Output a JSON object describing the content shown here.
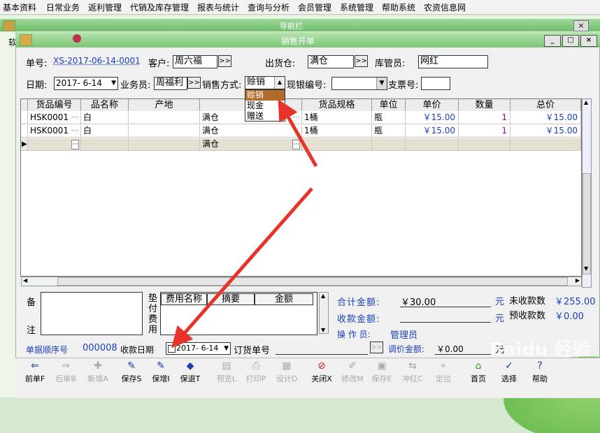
{
  "menu": [
    "基本资料",
    "日常业务",
    "返利管理",
    "代销及库存管理",
    "报表与统计",
    "查询与分析",
    "会员管理",
    "系统管理",
    "帮助系统",
    "农资信息网"
  ],
  "nav_window": {
    "title": "导航栏",
    "close": "×",
    "left_char": "软"
  },
  "sales_window": {
    "title": "销售开单",
    "btn_min": "_",
    "btn_max": "□",
    "btn_close": "×"
  },
  "header": {
    "order_no_label": "单号:",
    "order_no": "XS-2017-06-14-0001",
    "customer_label": "客户:",
    "customer": "周六福",
    "warehouse_label": "出货仓:",
    "warehouse": "满仓",
    "keeper_label": "库管员:",
    "keeper": "网红",
    "date_label": "日期:",
    "date": "2017- 6-14",
    "salesman_label": "业务员:",
    "salesman": "周福利",
    "sale_method_label": "销售方式:",
    "sale_method": "赊销",
    "cash_no_label": "现银编号:",
    "cash_no": "",
    "cheque_label": "支票号:",
    "cheque": "",
    "more_btn": ">>"
  },
  "sale_method_options": [
    "赊销",
    "现金",
    "赠送"
  ],
  "grid": {
    "columns": [
      "货品编号",
      "品名称",
      "产地",
      "出",
      "货品规格",
      "单位",
      "单价",
      "数量",
      "总价"
    ],
    "rows": [
      [
        "HSK0001",
        "白",
        "",
        "满仓",
        "1桶",
        "瓶",
        "￥15.00",
        "1",
        "￥15.00"
      ],
      [
        "HSK0001",
        "白",
        "",
        "满仓",
        "1桶",
        "瓶",
        "￥15.00",
        "1",
        "￥15.00"
      ],
      [
        "",
        "",
        "",
        "满仓",
        "",
        "",
        "",
        "",
        ""
      ]
    ],
    "cell_btn": "···",
    "row_pointer": "▶"
  },
  "bottom": {
    "remark_label_1": "备",
    "remark_label_2": "注",
    "advance_label": "垫付费用",
    "fee_columns": [
      "费用名称",
      "摘要",
      "金额"
    ],
    "total_label": "合计金额:",
    "total": "￥30.00",
    "yuan": "元",
    "unpaid_label": "未收款数",
    "unpaid": "￥255.00",
    "received_label": "收款金额:",
    "received": "",
    "prepaid_label": "预收款数",
    "prepaid": "￥0.00",
    "operator_label": "操 作 员:",
    "operator": "管理员",
    "seq_label": "单据顺序号",
    "seq": "000008",
    "collect_date_label": "收款日期",
    "collect_date": "2017- 6-14",
    "order_ref_label": "订货单号",
    "order_ref": "",
    "adjust_label": "调价金额:",
    "adjust": "￥0.00",
    "adjust_unit": "元"
  },
  "toolbar": [
    {
      "label": "前单F",
      "icon": "arrow-left-icon",
      "enabled": true
    },
    {
      "label": "后单B",
      "icon": "arrow-right-icon",
      "enabled": false
    },
    {
      "label": "新增A",
      "icon": "new-icon",
      "enabled": false
    },
    {
      "label": "保存S",
      "icon": "save-icon",
      "enabled": true
    },
    {
      "label": "保增I",
      "icon": "save-add-icon",
      "enabled": true
    },
    {
      "label": "保退T",
      "icon": "save-exit-icon",
      "enabled": true
    },
    {
      "label": "预览L",
      "icon": "preview-icon",
      "enabled": false
    },
    {
      "label": "打印P",
      "icon": "print-icon",
      "enabled": false
    },
    {
      "label": "设计D",
      "icon": "design-icon",
      "enabled": false
    },
    {
      "label": "关闭X",
      "icon": "close-icon",
      "enabled": true
    },
    {
      "label": "修改M",
      "icon": "edit-icon",
      "enabled": false
    },
    {
      "label": "保存E",
      "icon": "save2-icon",
      "enabled": false
    },
    {
      "label": "冲红C",
      "icon": "reverse-icon",
      "enabled": false
    },
    {
      "label": "定位",
      "icon": "locate-icon",
      "enabled": false
    },
    {
      "label": "首页",
      "icon": "home-icon",
      "enabled": true
    },
    {
      "label": "选择",
      "icon": "select-icon",
      "enabled": true
    },
    {
      "label": "帮助",
      "icon": "help-icon",
      "enabled": true
    }
  ],
  "right_chars": [
    "附",
    "单",
    "则",
    "近",
    "期",
    "材",
    "字",
    "查",
    "天"
  ],
  "watermark": "Baidu 经验",
  "colors": {
    "accent_blue": "#1a3fbf",
    "arrow_red": "#e8332a",
    "qty_magenta": "#b4007a",
    "title_green": "#7cc576"
  }
}
